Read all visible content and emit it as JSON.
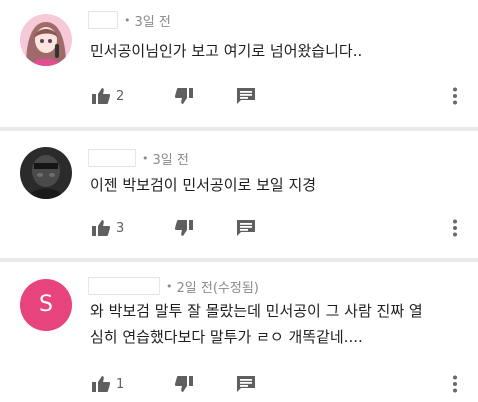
{
  "comments": [
    {
      "avatar_icon": "anime-girl-avatar",
      "time": "3일 전",
      "text": [
        "민서공이님인가 보고 여기로 넘어왔습니다.."
      ],
      "likes": "2"
    },
    {
      "avatar_icon": "dark-photo-avatar",
      "time": "3일 전",
      "text": [
        "이젠 박보검이 민서공이로 보일 지경"
      ],
      "likes": "3"
    },
    {
      "avatar_letter": "S",
      "avatar_color": "#e7437c",
      "time": "2일 전(수정됨)",
      "text": [
        "와 박보검 말투 잘 몰랐는데 민서공이 그 사람 진짜 열",
        "심히 연습했다보다 말투가 ㄹㅇ 개똑같네...."
      ],
      "likes": "1"
    }
  ],
  "icons": {
    "like": "thumb-up-icon",
    "dislike": "thumb-down-icon",
    "reply": "reply-icon",
    "more": "more-vert-icon"
  }
}
